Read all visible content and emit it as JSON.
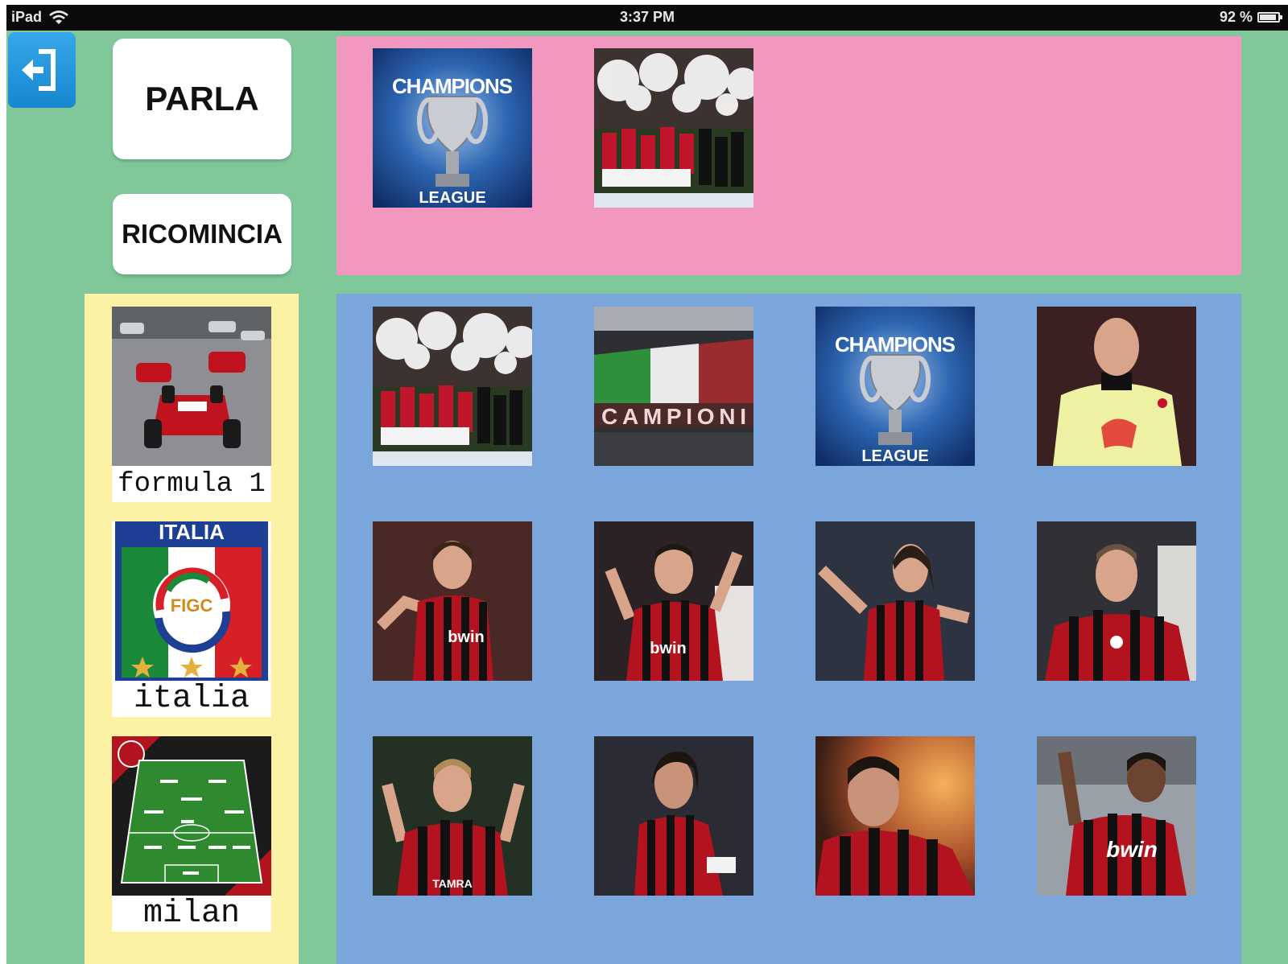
{
  "status_bar": {
    "device": "iPad",
    "time": "3:37 PM",
    "battery": "92 %",
    "battery_level": 0.92
  },
  "controls": {
    "exit_icon": "exit-door-icon",
    "speak_label": "PARLA",
    "restart_label": "RICOMINCIA"
  },
  "sentence": {
    "items": [
      {
        "name": "champions-league-trophy",
        "text": [
          "CHAMPIONS",
          "LEAGUE"
        ]
      },
      {
        "name": "team-celebration"
      }
    ]
  },
  "categories": [
    {
      "label": "formula 1",
      "image": "formula-1-race-cars"
    },
    {
      "label": "italia",
      "image": "figc-italia-logo",
      "logo_title": "ITALIA",
      "logo_badge": "FIGC"
    },
    {
      "label": "milan",
      "image": "milan-formation-pitch"
    }
  ],
  "grid": {
    "tiles": [
      {
        "name": "team-celebration"
      },
      {
        "name": "stadium-choreo",
        "text": "CAMPIONI"
      },
      {
        "name": "champions-league-trophy",
        "text": [
          "CHAMPIONS",
          "LEAGUE"
        ]
      },
      {
        "name": "goalkeeper-yellow-kit"
      },
      {
        "name": "player-long-hair-bwin",
        "sponsor": "bwin"
      },
      {
        "name": "player-arms-raised",
        "sponsor": "bwin"
      },
      {
        "name": "player-arms-spread"
      },
      {
        "name": "player-celebrating-shirt"
      },
      {
        "name": "player-fists-celebration",
        "sponsor": "TAMRA"
      },
      {
        "name": "player-captain-armband"
      },
      {
        "name": "player-closeup"
      },
      {
        "name": "player-smiling-bwin",
        "sponsor": "bwin"
      }
    ]
  },
  "colors": {
    "background": "#80c79a",
    "sentence_strip": "#f297c0",
    "category_panel": "#fcf2a6",
    "grid_panel": "#7aa6dc",
    "milan_red": "#c8102e",
    "exit_button": "#1d91d9"
  }
}
